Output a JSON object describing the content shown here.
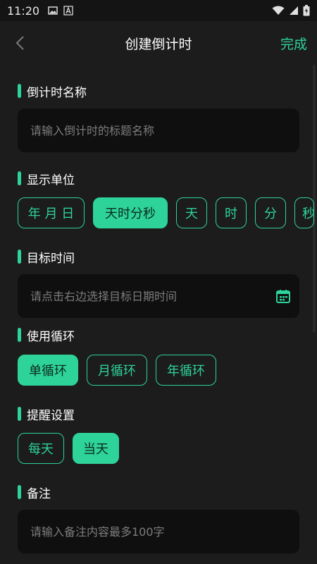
{
  "status_bar": {
    "time": "11:20",
    "icons": [
      "image-icon",
      "font-icon",
      "wifi-icon",
      "signal-icon",
      "battery-icon"
    ]
  },
  "nav": {
    "title": "创建倒计时",
    "done_label": "完成",
    "back_icon": "chevron-left-icon"
  },
  "sections": {
    "name": {
      "label": "倒计时名称",
      "placeholder": "请输入倒计时的标题名称"
    },
    "unit": {
      "label": "显示单位",
      "options": [
        "年 月 日",
        "天时分秒",
        "天",
        "时",
        "分",
        "秒"
      ],
      "selected": "天时分秒"
    },
    "target": {
      "label": "目标时间",
      "placeholder": "请点击右边选择目标日期时间",
      "icon": "calendar-icon"
    },
    "loop": {
      "label": "使用循环",
      "options": [
        "单循环",
        "月循环",
        "年循环"
      ],
      "selected": "单循环"
    },
    "reminder": {
      "label": "提醒设置",
      "options": [
        "每天",
        "当天"
      ],
      "selected": "当天"
    },
    "note": {
      "label": "备注",
      "placeholder": "请输入备注内容最多100字"
    }
  },
  "colors": {
    "accent": "#2ed39a",
    "background": "#1c1c1c",
    "input_bg": "#0f0f0f"
  }
}
